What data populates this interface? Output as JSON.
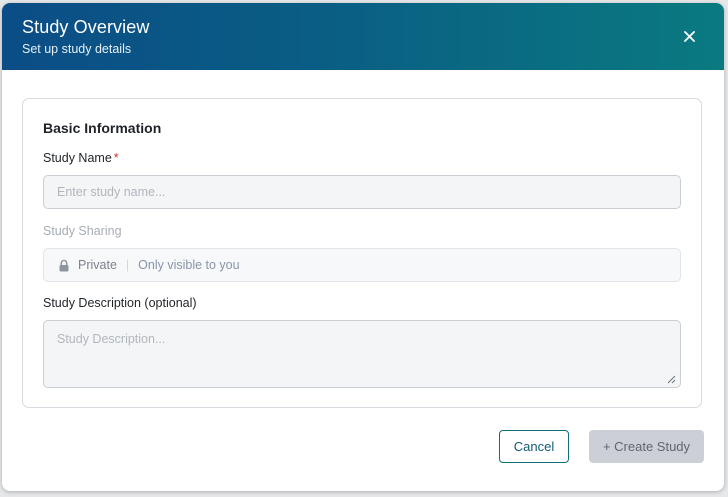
{
  "dialog": {
    "title": "Study Overview",
    "subtitle": "Set up study details",
    "close_icon": "close-icon"
  },
  "basic_info": {
    "section_title": "Basic Information",
    "study_name": {
      "label": "Study Name",
      "required_marker": "*",
      "value": "",
      "placeholder": "Enter study name..."
    },
    "study_sharing": {
      "label": "Study Sharing",
      "icon": "lock-icon",
      "value": "Private",
      "separator": "|",
      "hint": "Only visible to you"
    },
    "study_description": {
      "label": "Study Description (optional)",
      "value": "",
      "placeholder": "Study Description..."
    }
  },
  "footer": {
    "cancel_label": "Cancel",
    "create_label": "+ Create Study"
  },
  "colors": {
    "header_gradient_start": "#0b4d86",
    "header_gradient_end": "#0a7a80",
    "required": "#c0392b",
    "cancel_border": "#0e6e7a",
    "create_disabled_bg": "#ccd0d6"
  }
}
